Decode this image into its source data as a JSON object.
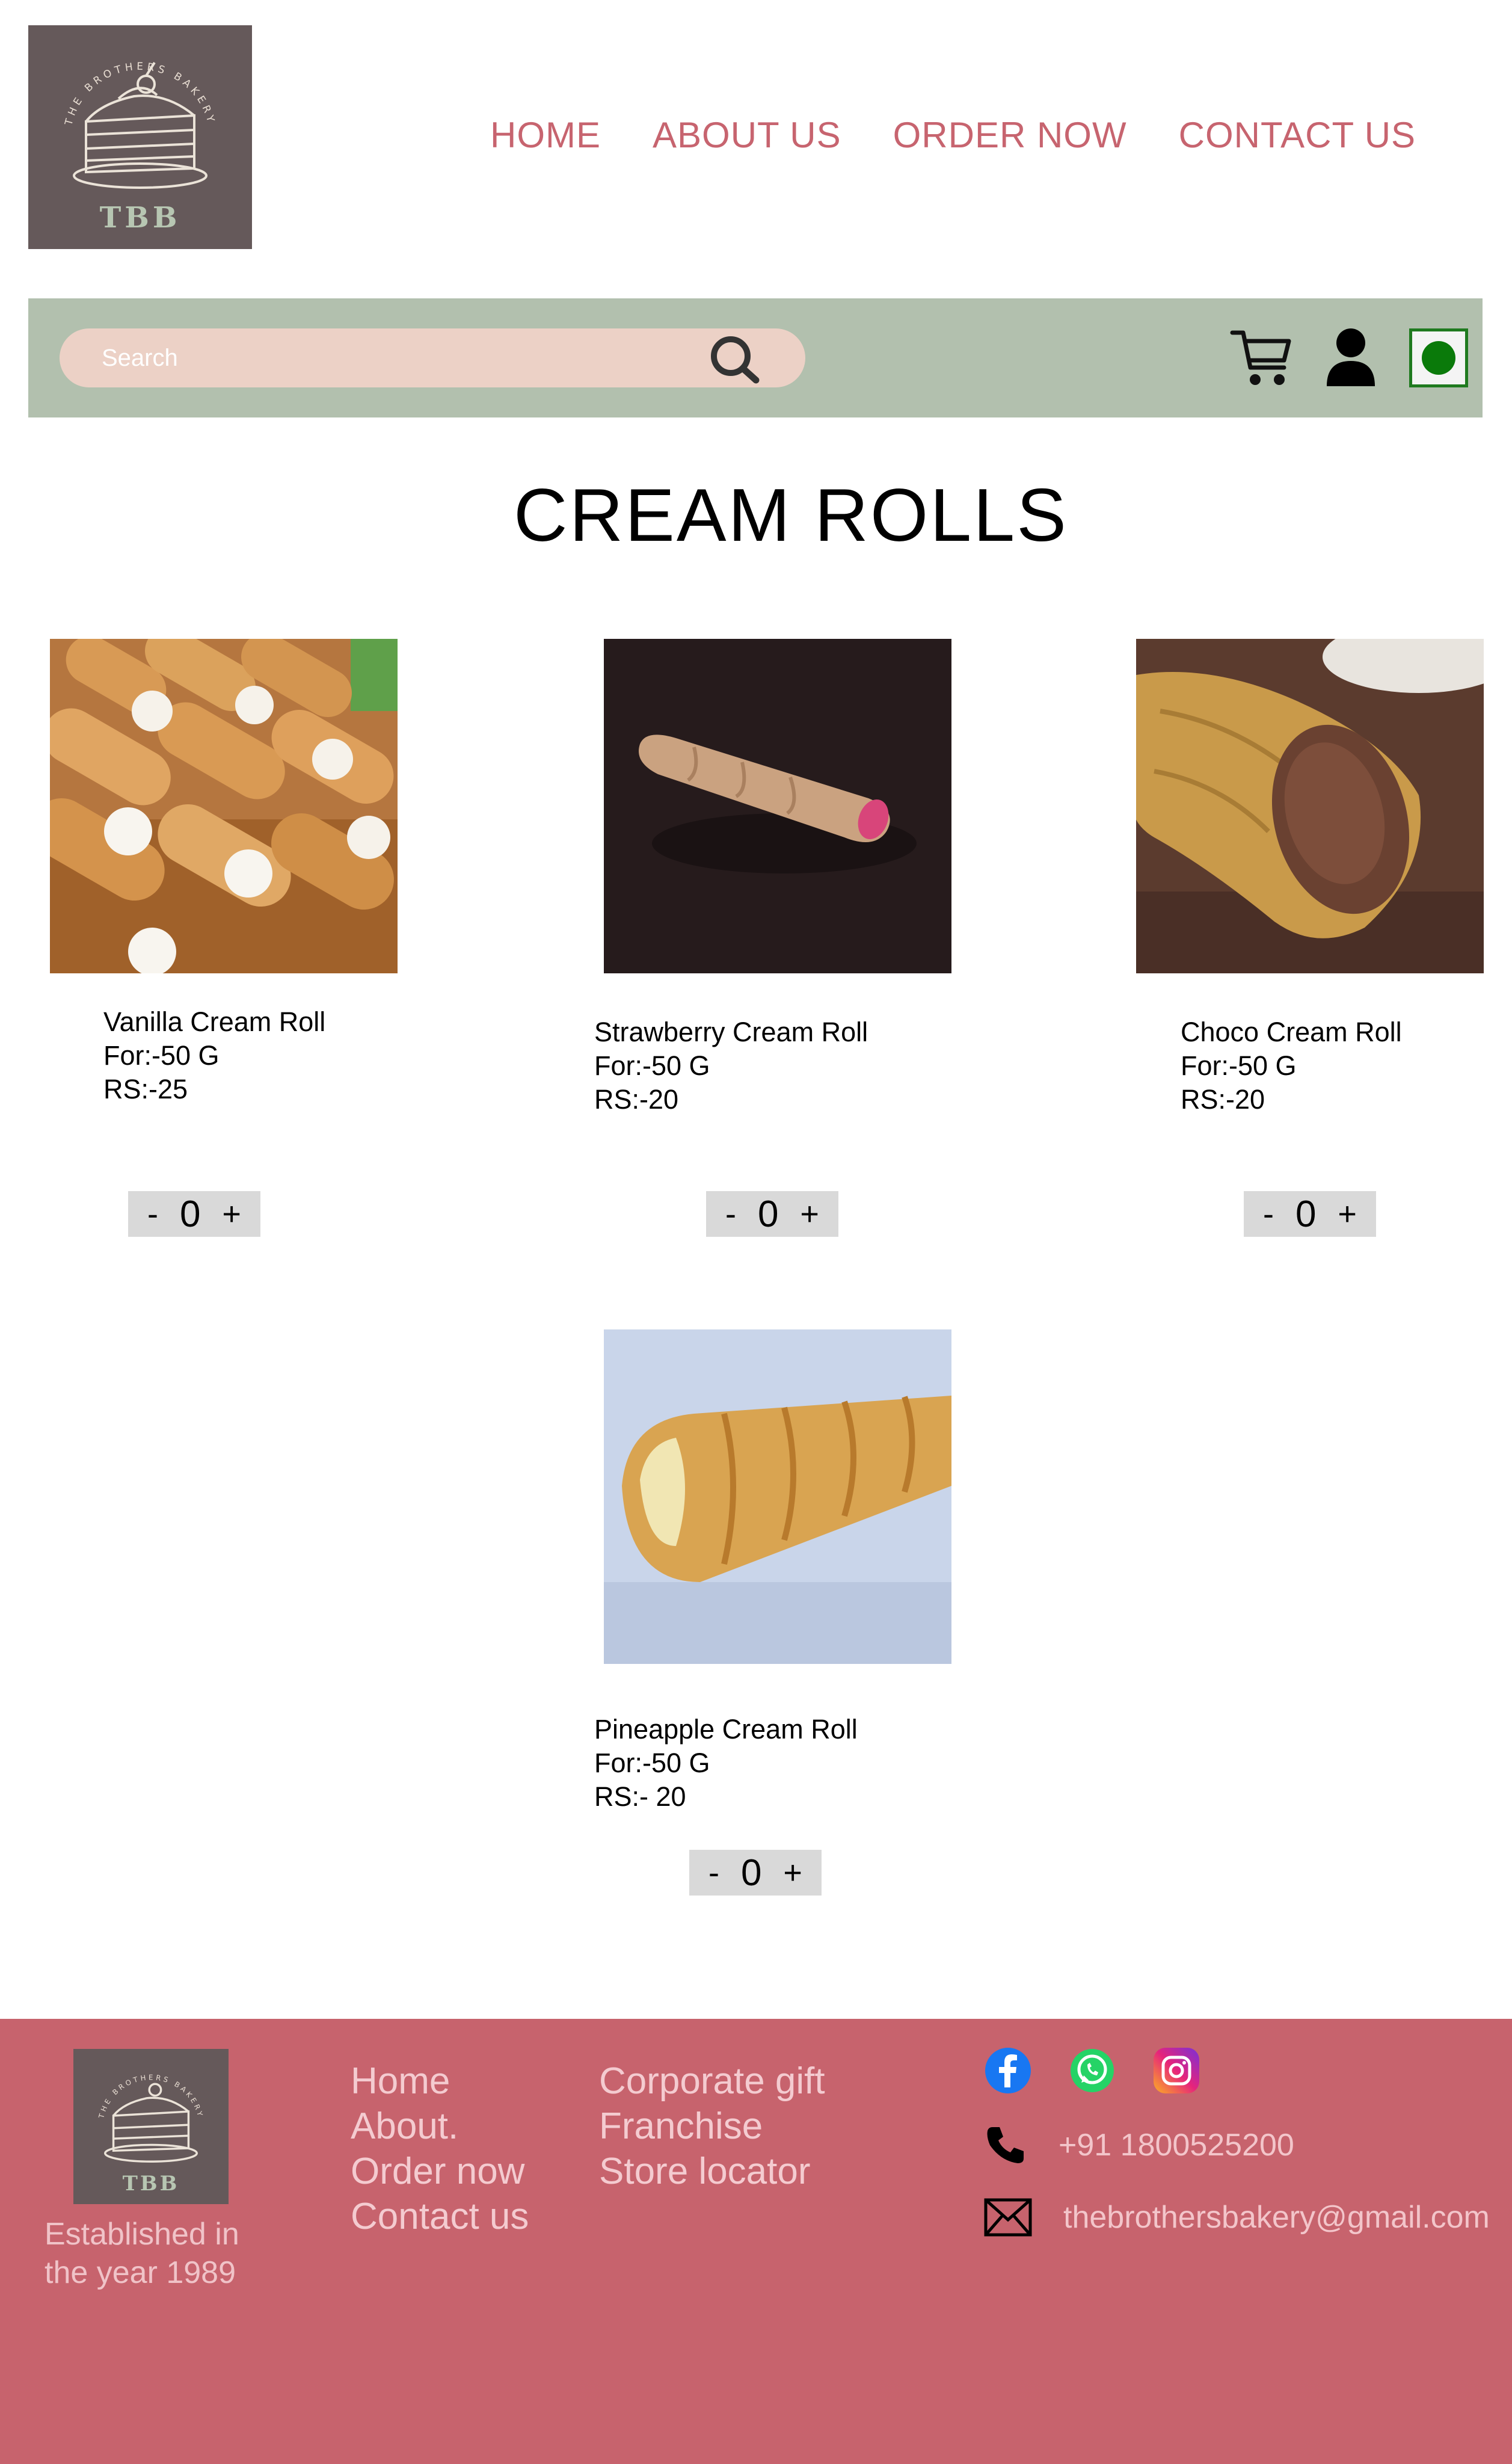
{
  "brand": {
    "monogram": "TBB",
    "ring_text": "THE BROTHERS BAKERY"
  },
  "nav": {
    "items": [
      "HOME",
      "ABOUT US",
      "ORDER NOW",
      "CONTACT US"
    ]
  },
  "search": {
    "placeholder": "Search"
  },
  "icons": {
    "search": "search-icon",
    "cart": "cart-icon",
    "account": "user-icon",
    "veg": "veg-mark-icon"
  },
  "page": {
    "title": "CREAM ROLLS"
  },
  "products": [
    {
      "name": "Vanilla Cream Roll",
      "weight": "For:-50 G",
      "price": "RS:-25",
      "qty": "0"
    },
    {
      "name": "Strawberry Cream Roll",
      "weight": "For:-50 G",
      "price": "RS:-20",
      "qty": "0"
    },
    {
      "name": "Choco Cream Roll",
      "weight": "For:-50 G",
      "price": "RS:-20",
      "qty": "0"
    },
    {
      "name": "Pineapple Cream Roll",
      "weight": "For:-50 G",
      "price": "RS:- 20",
      "qty": "0"
    }
  ],
  "qty_controls": {
    "minus": "-",
    "plus": "+"
  },
  "footer": {
    "established": [
      "Established in",
      "the year 1989"
    ],
    "links_col1": [
      "Home",
      "About.",
      "Order now",
      "Contact us"
    ],
    "links_col2": [
      "Corporate gift",
      "Franchise",
      "Store locator"
    ],
    "phone": "+91 1800525200",
    "email": "thebrothersbakery@gmail.com",
    "social": [
      "facebook-icon",
      "whatsapp-icon",
      "instagram-icon"
    ]
  },
  "colors": {
    "accent": "#c7646f",
    "strip": "#b2c0ae",
    "search_bg": "#ecd1c6",
    "footer_bg": "#c7636d",
    "logo_bg": "#65595a",
    "veg_green": "#0a7a0a"
  }
}
